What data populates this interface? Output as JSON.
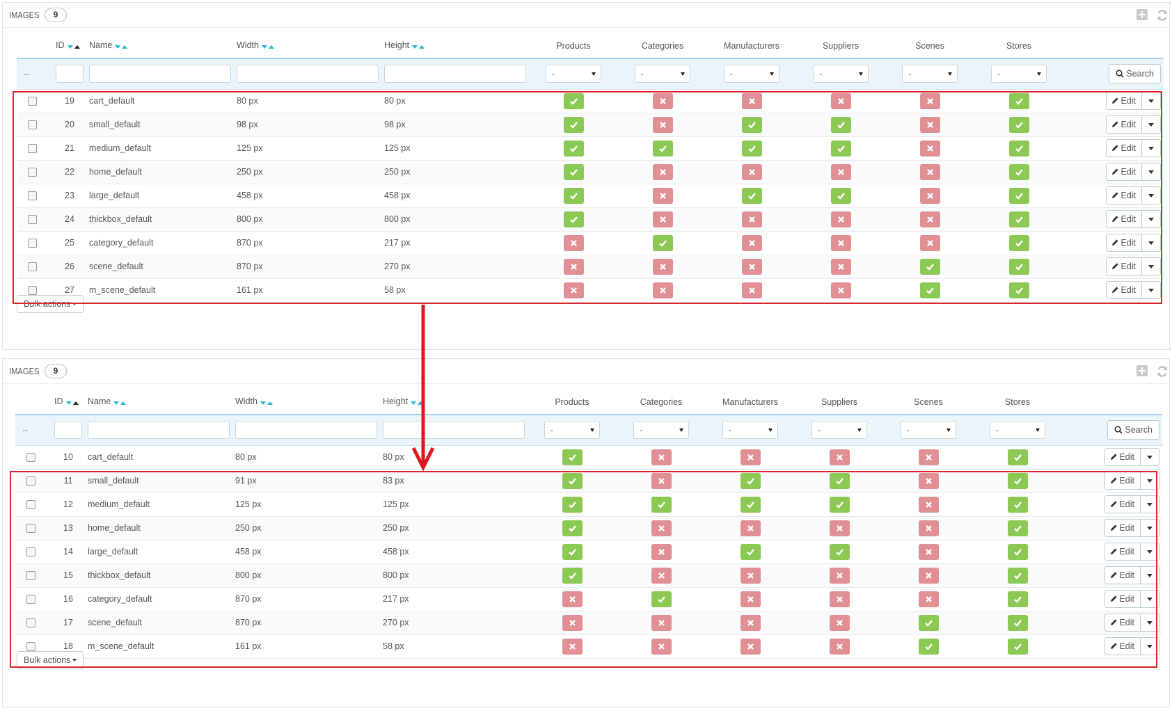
{
  "colors": {
    "accent": "#25b9d7",
    "yes": "#8bc954",
    "no": "#e08f95",
    "highlight": "#d9252b"
  },
  "columns": {
    "id": "ID",
    "name": "Name",
    "width": "Width",
    "height": "Height",
    "products": "Products",
    "categories": "Categories",
    "manufacturers": "Manufacturers",
    "suppliers": "Suppliers",
    "scenes": "Scenes",
    "stores": "Stores"
  },
  "filters": {
    "dash": "--",
    "select_value": "-",
    "search_label": "Search"
  },
  "edit_label": "Edit",
  "bulk_label": "Bulk actions",
  "panels": [
    {
      "title": "IMAGES",
      "count": "9",
      "rows": [
        {
          "id": "19",
          "name": "cart_default",
          "width": "80 px",
          "height": "80 px",
          "flags": [
            true,
            false,
            false,
            false,
            false,
            true
          ]
        },
        {
          "id": "20",
          "name": "small_default",
          "width": "98 px",
          "height": "98 px",
          "flags": [
            true,
            false,
            true,
            true,
            false,
            true
          ]
        },
        {
          "id": "21",
          "name": "medium_default",
          "width": "125 px",
          "height": "125 px",
          "flags": [
            true,
            true,
            true,
            true,
            false,
            true
          ]
        },
        {
          "id": "22",
          "name": "home_default",
          "width": "250 px",
          "height": "250 px",
          "flags": [
            true,
            false,
            false,
            false,
            false,
            true
          ]
        },
        {
          "id": "23",
          "name": "large_default",
          "width": "458 px",
          "height": "458 px",
          "flags": [
            true,
            false,
            true,
            true,
            false,
            true
          ]
        },
        {
          "id": "24",
          "name": "thickbox_default",
          "width": "800 px",
          "height": "800 px",
          "flags": [
            true,
            false,
            false,
            false,
            false,
            true
          ]
        },
        {
          "id": "25",
          "name": "category_default",
          "width": "870 px",
          "height": "217 px",
          "flags": [
            false,
            true,
            false,
            false,
            false,
            true
          ]
        },
        {
          "id": "26",
          "name": "scene_default",
          "width": "870 px",
          "height": "270 px",
          "flags": [
            false,
            false,
            false,
            false,
            true,
            true
          ]
        },
        {
          "id": "27",
          "name": "m_scene_default",
          "width": "161 px",
          "height": "58 px",
          "flags": [
            false,
            false,
            false,
            false,
            true,
            true
          ]
        }
      ]
    },
    {
      "title": "IMAGES",
      "count": "9",
      "rows": [
        {
          "id": "10",
          "name": "cart_default",
          "width": "80 px",
          "height": "80 px",
          "flags": [
            true,
            false,
            false,
            false,
            false,
            true
          ]
        },
        {
          "id": "11",
          "name": "small_default",
          "width": "91 px",
          "height": "83 px",
          "flags": [
            true,
            false,
            true,
            true,
            false,
            true
          ]
        },
        {
          "id": "12",
          "name": "medium_default",
          "width": "125 px",
          "height": "125 px",
          "flags": [
            true,
            true,
            true,
            true,
            false,
            true
          ]
        },
        {
          "id": "13",
          "name": "home_default",
          "width": "250 px",
          "height": "250 px",
          "flags": [
            true,
            false,
            false,
            false,
            false,
            true
          ]
        },
        {
          "id": "14",
          "name": "large_default",
          "width": "458 px",
          "height": "458 px",
          "flags": [
            true,
            false,
            true,
            true,
            false,
            true
          ]
        },
        {
          "id": "15",
          "name": "thickbox_default",
          "width": "800 px",
          "height": "800 px",
          "flags": [
            true,
            false,
            false,
            false,
            false,
            true
          ]
        },
        {
          "id": "16",
          "name": "category_default",
          "width": "870 px",
          "height": "217 px",
          "flags": [
            false,
            true,
            false,
            false,
            false,
            true
          ]
        },
        {
          "id": "17",
          "name": "scene_default",
          "width": "870 px",
          "height": "270 px",
          "flags": [
            false,
            false,
            false,
            false,
            true,
            true
          ]
        },
        {
          "id": "18",
          "name": "m_scene_default",
          "width": "161 px",
          "height": "58 px",
          "flags": [
            false,
            false,
            false,
            false,
            true,
            true
          ]
        }
      ]
    }
  ]
}
